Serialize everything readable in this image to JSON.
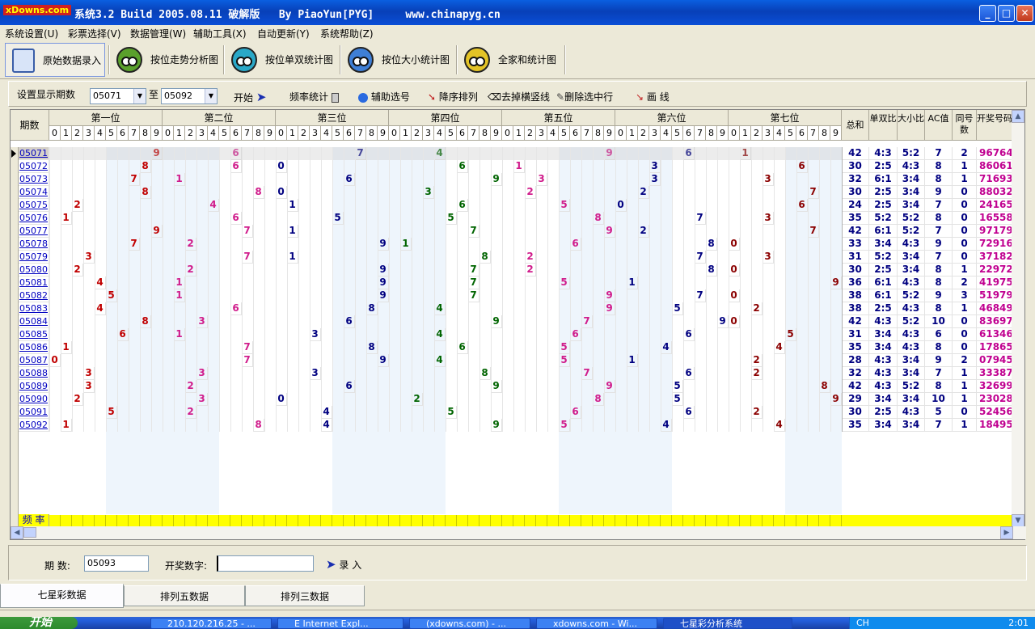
{
  "window": {
    "logo": "xDowns.com",
    "title": "系统3.2 Build 2005.08.11 破解版   By PiaoYun[PYG]     www.chinapyg.cn"
  },
  "menu": [
    "系统设置(U)",
    "彩票选择(V)",
    "数据管理(W)",
    "辅助工具(X)",
    "自动更新(Y)",
    "系统帮助(Z)"
  ],
  "toolbar": {
    "items": [
      "原始数据录入",
      "按位走势分析图",
      "按位单双统计图",
      "按位大小统计图",
      "全家和统计图"
    ],
    "bug_colors": [
      "#5aa02c",
      "#2aa8c8",
      "#3f7fd6",
      "#e3c326"
    ]
  },
  "controls": {
    "period_label": "设置显示期数",
    "from": "05071",
    "to_label": "至",
    "to": "05092",
    "start": "开始",
    "freq": "频率统计",
    "assist": "辅助选号",
    "sort": "降序排列",
    "remove_lines": "去掉横竖线",
    "delete_row": "删除选中行",
    "draw": "画 线"
  },
  "grid": {
    "period_header": "期数",
    "groups": [
      "第一位",
      "第二位",
      "第三位",
      "第四位",
      "第五位",
      "第六位",
      "第七位"
    ],
    "digit_headers": [
      "0",
      "1",
      "2",
      "3",
      "4",
      "5",
      "6",
      "7",
      "8",
      "9"
    ],
    "stat_headers": [
      "总和",
      "单双比",
      "大小比",
      "AC值",
      "同号数",
      "开奖号码"
    ],
    "digit_colors": [
      "#c00000",
      "#d01c8b",
      "#000080",
      "#006400",
      "#d01c8b",
      "#000080",
      "#8b0000"
    ],
    "freq_label": "频 率",
    "rows": [
      {
        "period": "05071",
        "digits": [
          9,
          6,
          7,
          4,
          9,
          6,
          1
        ],
        "sum": "42",
        "oe": "4:3",
        "bs": "5:2",
        "ac": "7",
        "same": "2",
        "code": "9676496"
      },
      {
        "period": "05072",
        "digits": [
          8,
          6,
          0,
          6,
          1,
          3,
          6
        ],
        "sum": "30",
        "oe": "2:5",
        "bs": "4:3",
        "ac": "8",
        "same": "1",
        "code": "8606136"
      },
      {
        "period": "05073",
        "digits": [
          7,
          1,
          6,
          9,
          3,
          3,
          3
        ],
        "sum": "32",
        "oe": "6:1",
        "bs": "3:4",
        "ac": "8",
        "same": "1",
        "code": "7169333"
      },
      {
        "period": "05074",
        "digits": [
          8,
          8,
          0,
          3,
          2,
          2,
          7
        ],
        "sum": "30",
        "oe": "2:5",
        "bs": "3:4",
        "ac": "9",
        "same": "0",
        "code": "8803227"
      },
      {
        "period": "05075",
        "digits": [
          2,
          4,
          1,
          6,
          5,
          0,
          6
        ],
        "sum": "24",
        "oe": "2:5",
        "bs": "3:4",
        "ac": "7",
        "same": "0",
        "code": "2416506"
      },
      {
        "period": "05076",
        "digits": [
          1,
          6,
          5,
          5,
          8,
          7,
          3
        ],
        "sum": "35",
        "oe": "5:2",
        "bs": "5:2",
        "ac": "8",
        "same": "0",
        "code": "1655873"
      },
      {
        "period": "05077",
        "digits": [
          9,
          7,
          1,
          7,
          9,
          2,
          7
        ],
        "sum": "42",
        "oe": "6:1",
        "bs": "5:2",
        "ac": "7",
        "same": "0",
        "code": "9717927"
      },
      {
        "period": "05078",
        "digits": [
          7,
          2,
          9,
          1,
          6,
          8,
          0
        ],
        "sum": "33",
        "oe": "3:4",
        "bs": "4:3",
        "ac": "9",
        "same": "0",
        "code": "7291680"
      },
      {
        "period": "05079",
        "digits": [
          3,
          7,
          1,
          8,
          2,
          7,
          3
        ],
        "sum": "31",
        "oe": "5:2",
        "bs": "3:4",
        "ac": "7",
        "same": "0",
        "code": "3718273"
      },
      {
        "period": "05080",
        "digits": [
          2,
          2,
          9,
          7,
          2,
          8,
          0
        ],
        "sum": "30",
        "oe": "2:5",
        "bs": "3:4",
        "ac": "8",
        "same": "1",
        "code": "2297280"
      },
      {
        "period": "05081",
        "digits": [
          4,
          1,
          9,
          7,
          5,
          1,
          9
        ],
        "sum": "36",
        "oe": "6:1",
        "bs": "4:3",
        "ac": "8",
        "same": "2",
        "code": "4197519"
      },
      {
        "period": "05082",
        "digits": [
          5,
          1,
          9,
          7,
          9,
          7,
          0
        ],
        "sum": "38",
        "oe": "6:1",
        "bs": "5:2",
        "ac": "9",
        "same": "3",
        "code": "5197970"
      },
      {
        "period": "05083",
        "digits": [
          4,
          6,
          8,
          4,
          9,
          5,
          2
        ],
        "sum": "38",
        "oe": "2:5",
        "bs": "4:3",
        "ac": "8",
        "same": "1",
        "code": "4684952"
      },
      {
        "period": "05084",
        "digits": [
          8,
          3,
          6,
          9,
          7,
          9,
          0
        ],
        "sum": "42",
        "oe": "4:3",
        "bs": "5:2",
        "ac": "10",
        "same": "0",
        "code": "8369790"
      },
      {
        "period": "05085",
        "digits": [
          6,
          1,
          3,
          4,
          6,
          6,
          5
        ],
        "sum": "31",
        "oe": "3:4",
        "bs": "4:3",
        "ac": "6",
        "same": "0",
        "code": "6134665"
      },
      {
        "period": "05086",
        "digits": [
          1,
          7,
          8,
          6,
          5,
          4,
          4
        ],
        "sum": "35",
        "oe": "3:4",
        "bs": "4:3",
        "ac": "8",
        "same": "0",
        "code": "1786544"
      },
      {
        "period": "05087",
        "digits": [
          0,
          7,
          9,
          4,
          5,
          1,
          2
        ],
        "sum": "28",
        "oe": "4:3",
        "bs": "3:4",
        "ac": "9",
        "same": "2",
        "code": "0794512"
      },
      {
        "period": "05088",
        "digits": [
          3,
          3,
          3,
          8,
          7,
          6,
          2
        ],
        "sum": "32",
        "oe": "4:3",
        "bs": "3:4",
        "ac": "7",
        "same": "1",
        "code": "3338762"
      },
      {
        "period": "05089",
        "digits": [
          3,
          2,
          6,
          9,
          9,
          5,
          8
        ],
        "sum": "42",
        "oe": "4:3",
        "bs": "5:2",
        "ac": "8",
        "same": "1",
        "code": "3269958"
      },
      {
        "period": "05090",
        "digits": [
          2,
          3,
          0,
          2,
          8,
          5,
          9
        ],
        "sum": "29",
        "oe": "3:4",
        "bs": "3:4",
        "ac": "10",
        "same": "1",
        "code": "2302859"
      },
      {
        "period": "05091",
        "digits": [
          5,
          2,
          4,
          5,
          6,
          6,
          2
        ],
        "sum": "30",
        "oe": "2:5",
        "bs": "4:3",
        "ac": "5",
        "same": "0",
        "code": "5245662"
      },
      {
        "period": "05092",
        "digits": [
          1,
          8,
          4,
          9,
          5,
          4,
          4
        ],
        "sum": "35",
        "oe": "3:4",
        "bs": "3:4",
        "ac": "7",
        "same": "1",
        "code": "1849544"
      }
    ]
  },
  "input": {
    "period_label": "期  数:",
    "period_value": "05093",
    "code_label": "开奖数字:",
    "code_value": "",
    "submit": "录  入"
  },
  "tabs": [
    "七星彩数据",
    "排列五数据",
    "排列三数据"
  ],
  "status": "",
  "taskbar": {
    "start": "开始",
    "tasks": [
      "210.120.216.25 - ...",
      "E Internet Expl...",
      "(xdowns.com) - ...",
      "xdowns.com - Wi...",
      "七星彩分析系统"
    ],
    "tray_lang": "CH",
    "clock": "2:01"
  }
}
